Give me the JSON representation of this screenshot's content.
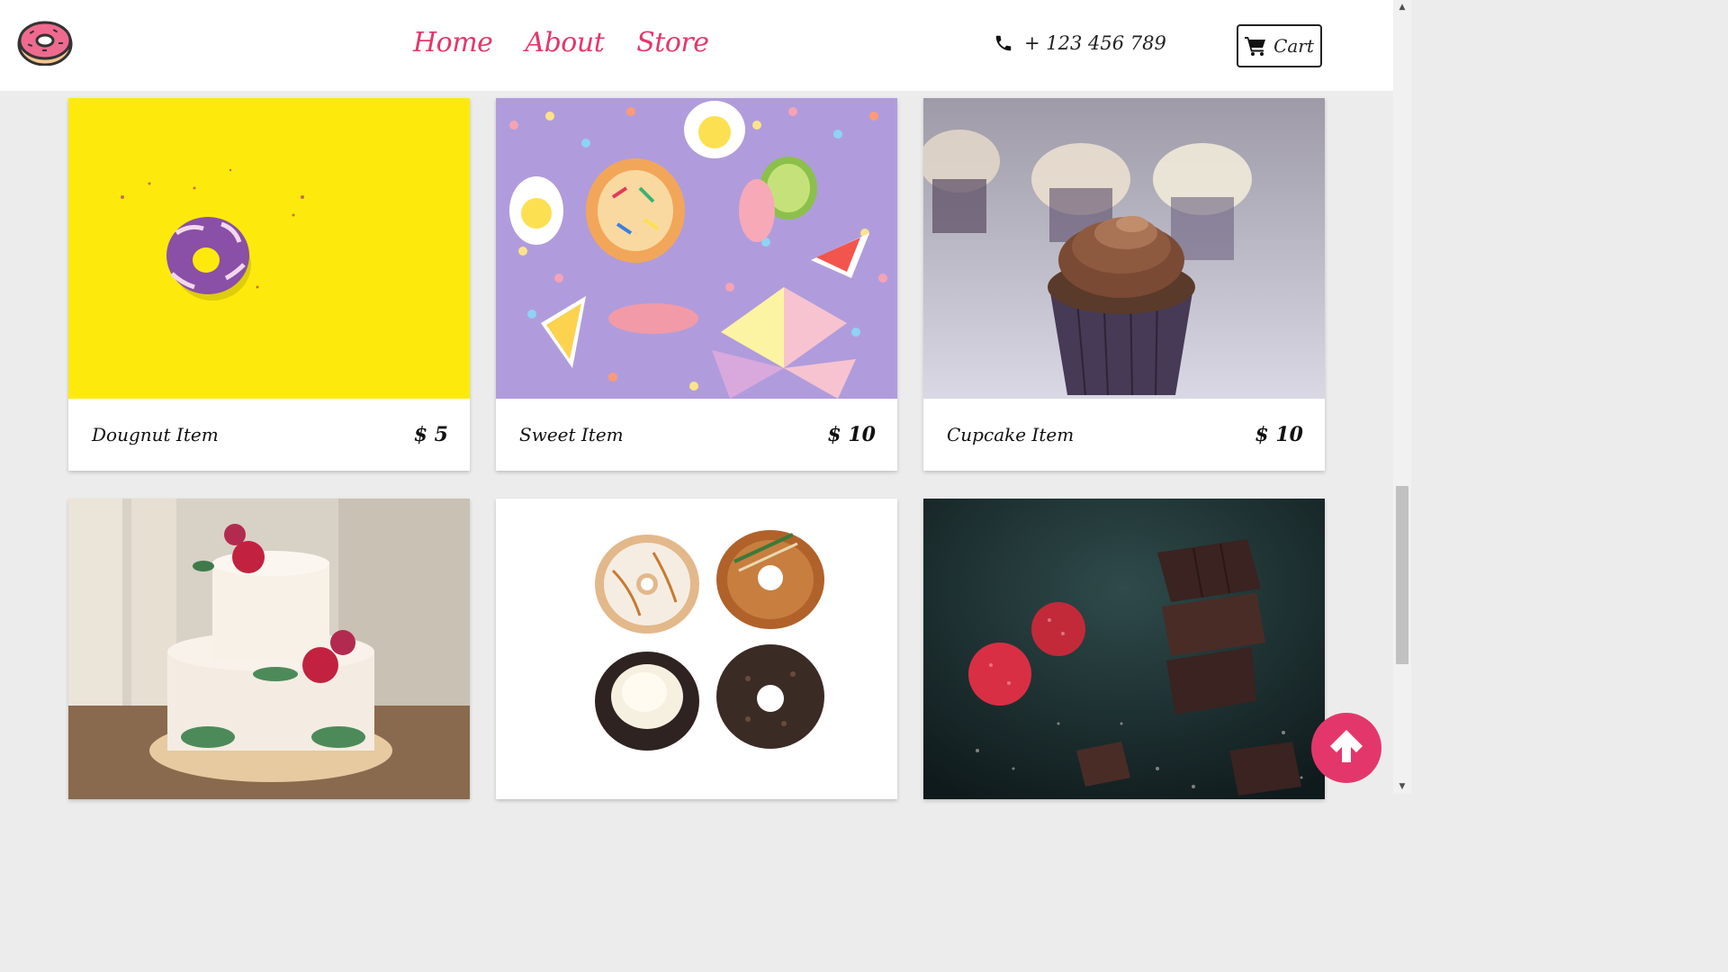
{
  "header": {
    "nav": [
      {
        "label": "Home"
      },
      {
        "label": "About"
      },
      {
        "label": "Store"
      }
    ],
    "phone": "+ 123 456 789",
    "cart_label": "Cart"
  },
  "products": [
    {
      "name": "Dougnut Item",
      "price": "$ 5"
    },
    {
      "name": "Sweet Item",
      "price": "$ 10"
    },
    {
      "name": "Cupcake Item",
      "price": "$ 10"
    }
  ],
  "colors": {
    "accent": "#e3376b",
    "background": "#ececec"
  },
  "icons": {
    "logo": "donut-logo-icon",
    "phone": "phone-icon",
    "cart": "cart-icon",
    "to_top": "arrow-up-icon"
  }
}
